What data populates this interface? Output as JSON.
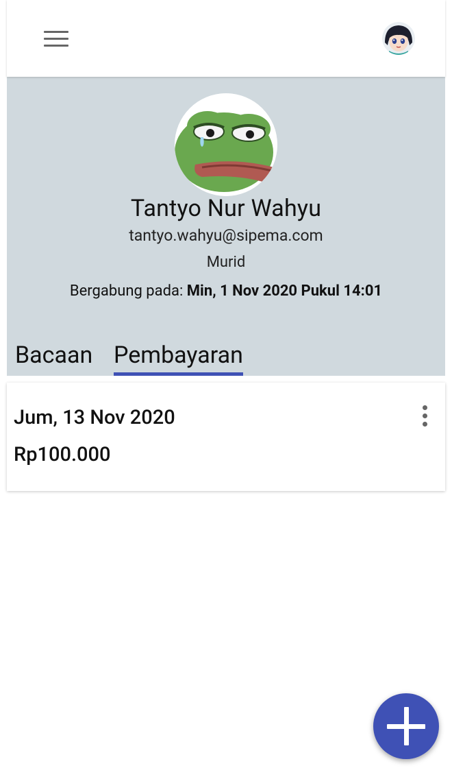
{
  "app_bar": {
    "menu_icon": "hamburger-menu-icon",
    "account_avatar": "user-avatar-anime-girl"
  },
  "profile": {
    "avatar": "profile-avatar-frog",
    "name": "Tantyo Nur Wahyu",
    "email": "tantyo.wahyu@sipema.com",
    "role": "Murid",
    "joined_label": "Bergabung pada: ",
    "joined_value": "Min, 1 Nov 2020 Pukul 14:01"
  },
  "tabs": [
    {
      "label": "Bacaan",
      "active": false
    },
    {
      "label": "Pembayaran",
      "active": true
    }
  ],
  "payments": [
    {
      "date": "Jum, 13 Nov 2020",
      "amount": "Rp100.000",
      "menu_icon": "more-vertical-icon"
    }
  ],
  "fab": {
    "icon": "add-icon"
  },
  "colors": {
    "accent": "#3f51b5",
    "profile_bg": "#d0d9de",
    "surface": "#ffffff"
  }
}
